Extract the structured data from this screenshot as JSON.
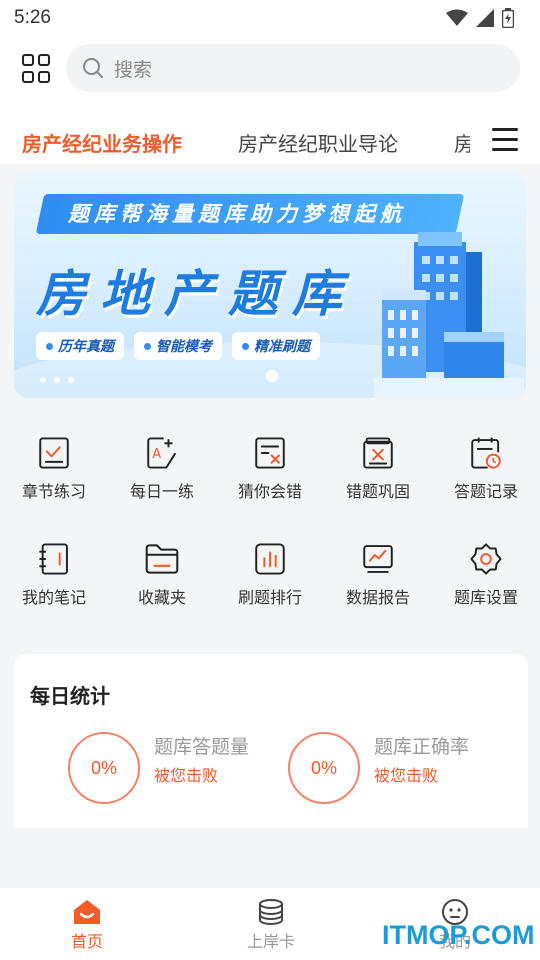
{
  "status": {
    "time": "5:26"
  },
  "search": {
    "placeholder": "搜索",
    "icon": "search-icon"
  },
  "tabs": [
    {
      "label": "房产经纪业务操作",
      "active": true
    },
    {
      "label": "房产经纪职业导论",
      "active": false
    },
    {
      "label": "房",
      "active": false
    }
  ],
  "banner": {
    "ribbon": "题库帮海量题库助力梦想起航",
    "headline": "房地产题库",
    "chips": [
      "历年真题",
      "智能模考",
      "精准刷题"
    ]
  },
  "grid": [
    {
      "label": "章节练习",
      "icon": "checklist-icon"
    },
    {
      "label": "每日一练",
      "icon": "daily-practice-icon"
    },
    {
      "label": "猜你会错",
      "icon": "wrong-guess-icon"
    },
    {
      "label": "错题巩固",
      "icon": "mistake-review-icon"
    },
    {
      "label": "答题记录",
      "icon": "answer-record-icon"
    },
    {
      "label": "我的笔记",
      "icon": "notebook-icon"
    },
    {
      "label": "收藏夹",
      "icon": "folder-icon"
    },
    {
      "label": "刷题排行",
      "icon": "ranking-icon"
    },
    {
      "label": "数据报告",
      "icon": "data-report-icon"
    },
    {
      "label": "题库设置",
      "icon": "settings-icon"
    }
  ],
  "daily": {
    "title": "每日统计",
    "stats": [
      {
        "value": "0%",
        "label": "题库答题量",
        "sub": "被您击败"
      },
      {
        "value": "0%",
        "label": "题库正确率",
        "sub": "被您击败"
      }
    ]
  },
  "nav": [
    {
      "label": "首页",
      "icon": "home-icon",
      "active": true
    },
    {
      "label": "上岸卡",
      "icon": "coins-icon",
      "active": false
    },
    {
      "label": "我的",
      "icon": "profile-icon",
      "active": false
    }
  ],
  "watermark": "ITMOP.COM",
  "colors": {
    "accent": "#f25c2a",
    "banner_blue": "#1e7be0"
  }
}
